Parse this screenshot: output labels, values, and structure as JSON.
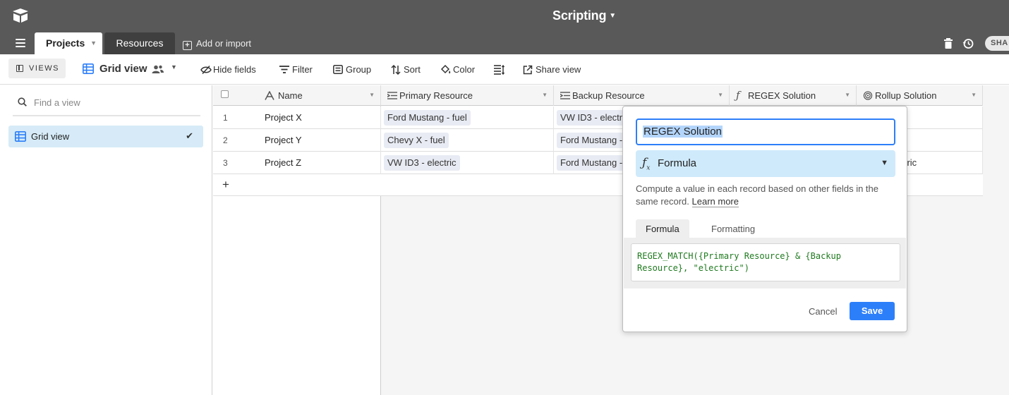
{
  "app": {
    "base_name": "Scripting"
  },
  "tabs": [
    {
      "label": "Projects",
      "active": true
    },
    {
      "label": "Resources",
      "active": false
    }
  ],
  "add_import_label": "Add or import",
  "share_label": "SHA",
  "viewbar": {
    "views_label": "VIEWS",
    "current_view": "Grid view",
    "tools": {
      "hide_fields": "Hide fields",
      "filter": "Filter",
      "group": "Group",
      "sort": "Sort",
      "color": "Color",
      "share_view": "Share view"
    }
  },
  "sidebar": {
    "search_placeholder": "Find a view",
    "views": [
      {
        "label": "Grid view",
        "selected": true
      }
    ]
  },
  "grid": {
    "columns": [
      {
        "label": "Name",
        "icon": "text-icon"
      },
      {
        "label": "Primary Resource",
        "icon": "link-icon"
      },
      {
        "label": "Backup Resource",
        "icon": "link-icon"
      },
      {
        "label": "REGEX Solution",
        "icon": "formula-icon"
      },
      {
        "label": "Rollup Solution",
        "icon": "rollup-icon"
      }
    ],
    "rows": [
      {
        "num": "1",
        "name": "Project X",
        "primary": "Ford Mustang - fuel",
        "backup": "VW ID3 - electr",
        "rollup": ""
      },
      {
        "num": "2",
        "name": "Project Y",
        "primary": "Chevy X - fuel",
        "backup": "Ford Mustang -",
        "rollup": ""
      },
      {
        "num": "3",
        "name": "Project Z",
        "primary": "VW ID3 - electric",
        "backup": "Ford Mustang -",
        "rollup": "electric"
      }
    ],
    "add_row_symbol": "+"
  },
  "field_editor": {
    "field_name": "REGEX Solution",
    "field_type": "Formula",
    "description": "Compute a value in each record based on other fields in the same record.",
    "learn_more": "Learn more",
    "tabs": [
      "Formula",
      "Formatting"
    ],
    "formula": "REGEX_MATCH({Primary Resource} & {Backup Resource}, \"electric\")",
    "cancel_label": "Cancel",
    "save_label": "Save"
  },
  "colors": {
    "topbar": "#595959",
    "accent_blue": "#2d7ff9",
    "selected_view_bg": "#d6ebf7",
    "formula_green": "#1f7a1f"
  }
}
